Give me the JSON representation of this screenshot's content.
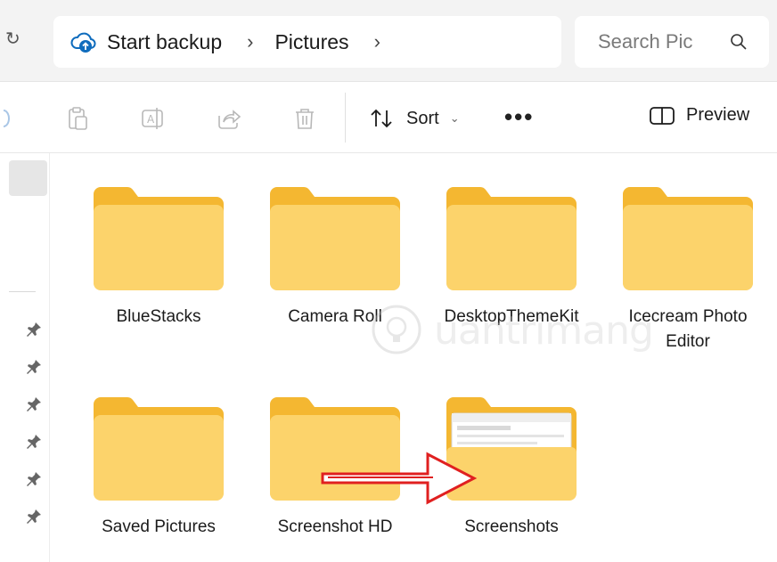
{
  "address_bar": {
    "crumbs": [
      "Start backup",
      "Pictures"
    ],
    "chevron": "›"
  },
  "search": {
    "placeholder": "Search Pic"
  },
  "toolbar": {
    "sort_label": "Sort",
    "more_label": "•••",
    "preview_label": "Preview",
    "icons": [
      "paste-icon",
      "rename-icon",
      "share-icon",
      "delete-icon"
    ]
  },
  "folders": [
    {
      "name": "BlueStacks",
      "type": "plain"
    },
    {
      "name": "Camera Roll",
      "type": "plain"
    },
    {
      "name": "DesktopThemeKit",
      "type": "plain"
    },
    {
      "name": "Icecream Photo Editor",
      "type": "plain"
    },
    {
      "name": "Saved Pictures",
      "type": "plain"
    },
    {
      "name": "Screenshot HD",
      "type": "plain"
    },
    {
      "name": "Screenshots",
      "type": "with-preview"
    }
  ],
  "colors": {
    "folder_back": "#f4b731",
    "folder_front": "#fcd36b",
    "arrow": "#e02020"
  }
}
